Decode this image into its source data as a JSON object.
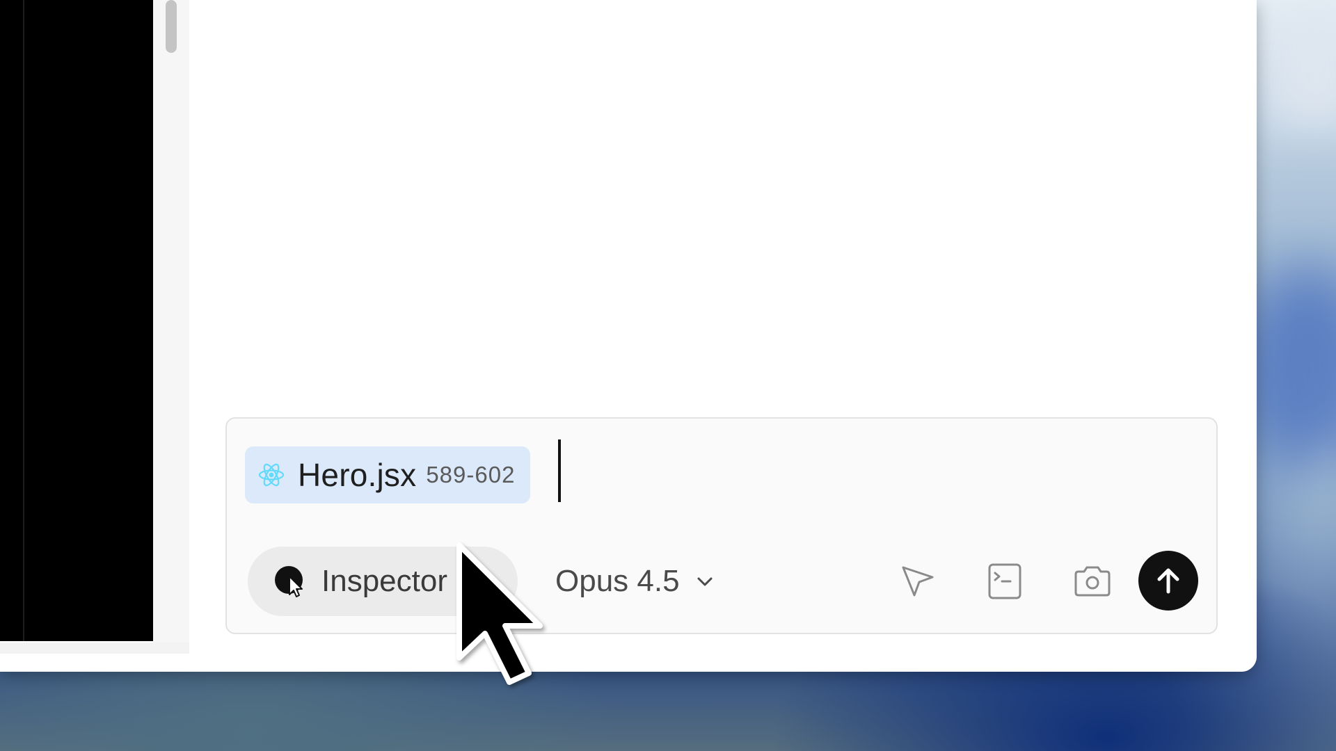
{
  "composer": {
    "attachment": {
      "icon": "react-icon",
      "file_name": "Hero.jsx",
      "line_range": "589-602"
    },
    "inspector_button": {
      "icon": "inspector-icon",
      "label": "Inspector"
    },
    "model_selector": {
      "label": "Opus 4.5",
      "icon": "chevron-down-icon"
    },
    "tools": [
      "pointer-select-icon",
      "terminal-icon",
      "camera-icon"
    ],
    "send_button": {
      "icon": "arrow-up-icon"
    }
  },
  "colors": {
    "chip_background": "#dbe9fa",
    "react_logo": "#61dafb",
    "send_button": "#111111",
    "inspector_background": "#ebebeb"
  }
}
